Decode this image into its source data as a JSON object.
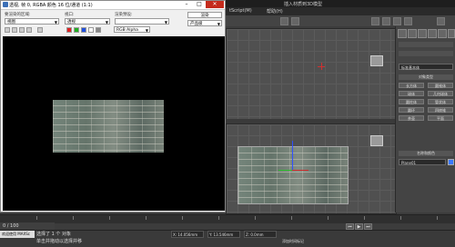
{
  "app": {
    "title": "插入材质到3D模型",
    "menu": [
      "tScript(M)",
      "帮助(H)"
    ],
    "viewports": [
      {
        "label": ""
      },
      {
        "label": ""
      }
    ],
    "command_panel": {
      "dropdown": "标准基本体",
      "object_type_header": "对象类型",
      "buttons": [
        "长方体",
        "圆锥体",
        "球体",
        "几何球体",
        "圆柱体",
        "管状体",
        "圆环",
        "四棱锥",
        "茶壶",
        "平面"
      ],
      "name_color_header": "名称和颜色",
      "object_name": "Plane01"
    },
    "status": {
      "maxscript_label": "欢迎使用 MAXSc",
      "selection": "选择了 1 个 对象",
      "hint": "单击并拖动以选择并移",
      "coord_x": "X: 14.056mm",
      "coord_y": "Y: 13.546mm",
      "coord_z": "Z: 0.0mm",
      "add_time_tag": "添加时间标记"
    },
    "time_slider": "0 / 100"
  },
  "frame_window": {
    "title": "透视, 帧 0, RGBA 颜色 16 位/通道 (1:1)",
    "area_label": "要渲染的区域:",
    "area_value": "视图",
    "viewport_label": "视口:",
    "viewport_value": "透视",
    "preset_label": "渲染预设:",
    "preset_value": "",
    "render_button": "渲染",
    "production_value": "产品级",
    "channel_value": "RGB Alpha",
    "colors": {
      "red": "#e02020",
      "green": "#20b020",
      "blue": "#2050e0"
    }
  }
}
